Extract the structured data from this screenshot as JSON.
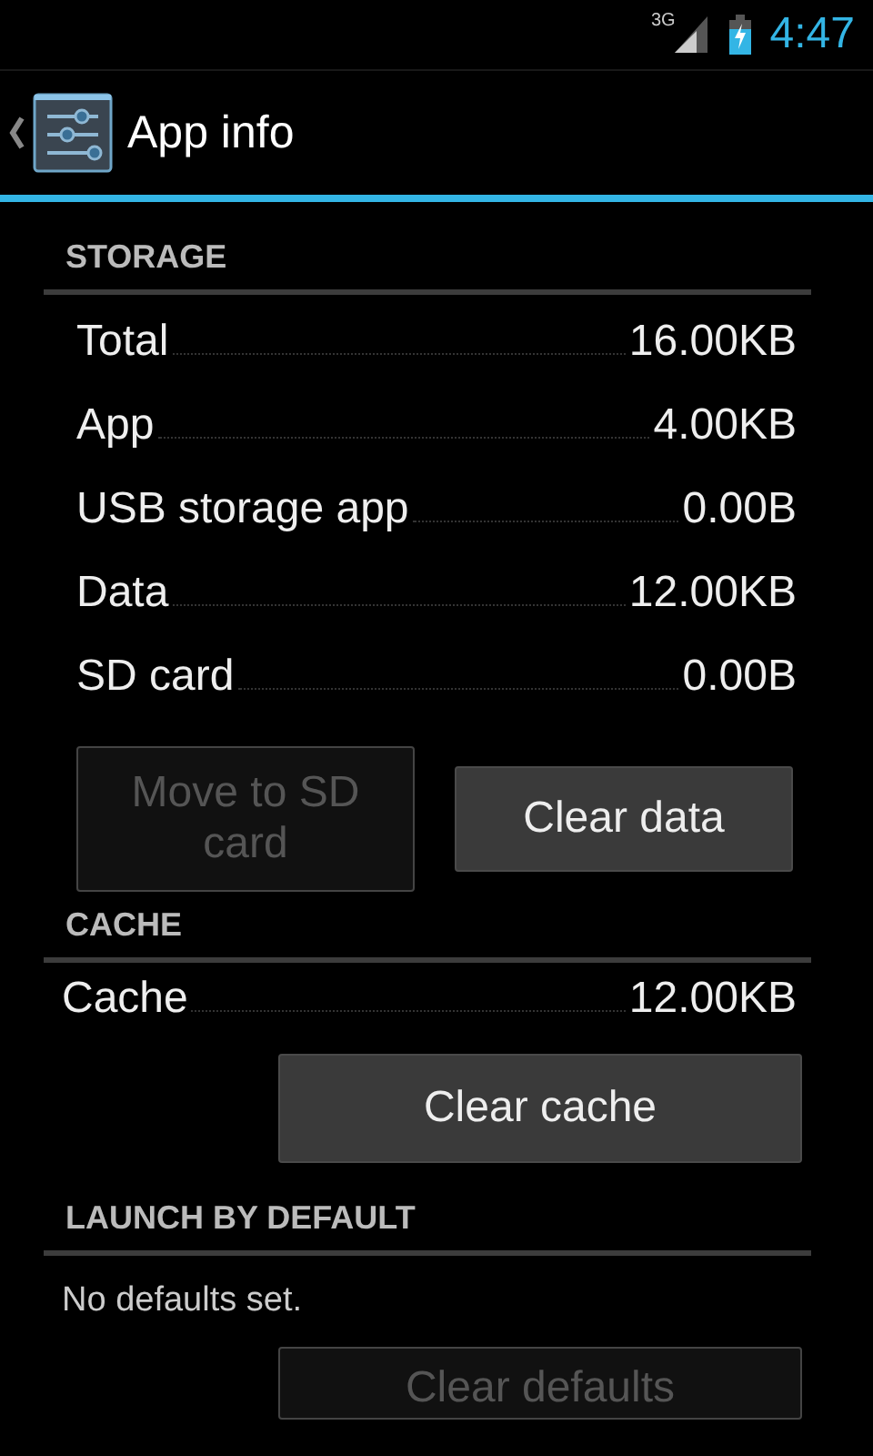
{
  "status_bar": {
    "network": "3G",
    "time": "4:47"
  },
  "action_bar": {
    "title": "App info"
  },
  "storage": {
    "header": "STORAGE",
    "rows": [
      {
        "label": "Total",
        "value": "16.00KB"
      },
      {
        "label": "App",
        "value": "4.00KB"
      },
      {
        "label": "USB storage app",
        "value": "0.00B"
      },
      {
        "label": "Data",
        "value": "12.00KB"
      },
      {
        "label": "SD card",
        "value": "0.00B"
      }
    ],
    "buttons": [
      {
        "label": "Move to SD card",
        "disabled": true
      },
      {
        "label": "Clear data",
        "disabled": false
      }
    ]
  },
  "cache": {
    "header": "CACHE",
    "row": {
      "label": "Cache",
      "value": "12.00KB"
    },
    "button": {
      "label": "Clear cache",
      "disabled": false
    }
  },
  "launch": {
    "header": "LAUNCH BY DEFAULT",
    "text": "No defaults set.",
    "button": {
      "label": "Clear defaults",
      "disabled": true
    }
  }
}
